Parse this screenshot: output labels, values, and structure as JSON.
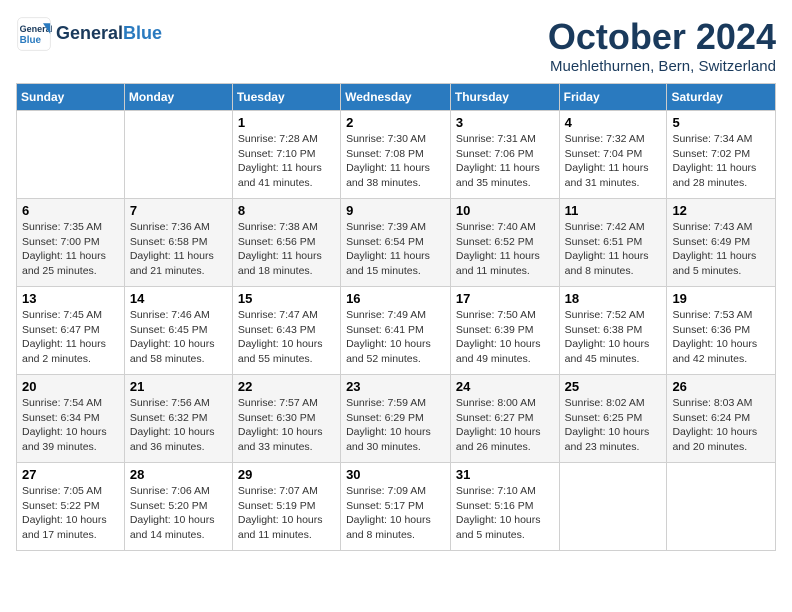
{
  "header": {
    "logo_line1": "General",
    "logo_line2": "Blue",
    "month": "October 2024",
    "location": "Muehlethurnen, Bern, Switzerland"
  },
  "days_of_week": [
    "Sunday",
    "Monday",
    "Tuesday",
    "Wednesday",
    "Thursday",
    "Friday",
    "Saturday"
  ],
  "weeks": [
    [
      {
        "day": "",
        "info": ""
      },
      {
        "day": "",
        "info": ""
      },
      {
        "day": "1",
        "info": "Sunrise: 7:28 AM\nSunset: 7:10 PM\nDaylight: 11 hours and 41 minutes."
      },
      {
        "day": "2",
        "info": "Sunrise: 7:30 AM\nSunset: 7:08 PM\nDaylight: 11 hours and 38 minutes."
      },
      {
        "day": "3",
        "info": "Sunrise: 7:31 AM\nSunset: 7:06 PM\nDaylight: 11 hours and 35 minutes."
      },
      {
        "day": "4",
        "info": "Sunrise: 7:32 AM\nSunset: 7:04 PM\nDaylight: 11 hours and 31 minutes."
      },
      {
        "day": "5",
        "info": "Sunrise: 7:34 AM\nSunset: 7:02 PM\nDaylight: 11 hours and 28 minutes."
      }
    ],
    [
      {
        "day": "6",
        "info": "Sunrise: 7:35 AM\nSunset: 7:00 PM\nDaylight: 11 hours and 25 minutes."
      },
      {
        "day": "7",
        "info": "Sunrise: 7:36 AM\nSunset: 6:58 PM\nDaylight: 11 hours and 21 minutes."
      },
      {
        "day": "8",
        "info": "Sunrise: 7:38 AM\nSunset: 6:56 PM\nDaylight: 11 hours and 18 minutes."
      },
      {
        "day": "9",
        "info": "Sunrise: 7:39 AM\nSunset: 6:54 PM\nDaylight: 11 hours and 15 minutes."
      },
      {
        "day": "10",
        "info": "Sunrise: 7:40 AM\nSunset: 6:52 PM\nDaylight: 11 hours and 11 minutes."
      },
      {
        "day": "11",
        "info": "Sunrise: 7:42 AM\nSunset: 6:51 PM\nDaylight: 11 hours and 8 minutes."
      },
      {
        "day": "12",
        "info": "Sunrise: 7:43 AM\nSunset: 6:49 PM\nDaylight: 11 hours and 5 minutes."
      }
    ],
    [
      {
        "day": "13",
        "info": "Sunrise: 7:45 AM\nSunset: 6:47 PM\nDaylight: 11 hours and 2 minutes."
      },
      {
        "day": "14",
        "info": "Sunrise: 7:46 AM\nSunset: 6:45 PM\nDaylight: 10 hours and 58 minutes."
      },
      {
        "day": "15",
        "info": "Sunrise: 7:47 AM\nSunset: 6:43 PM\nDaylight: 10 hours and 55 minutes."
      },
      {
        "day": "16",
        "info": "Sunrise: 7:49 AM\nSunset: 6:41 PM\nDaylight: 10 hours and 52 minutes."
      },
      {
        "day": "17",
        "info": "Sunrise: 7:50 AM\nSunset: 6:39 PM\nDaylight: 10 hours and 49 minutes."
      },
      {
        "day": "18",
        "info": "Sunrise: 7:52 AM\nSunset: 6:38 PM\nDaylight: 10 hours and 45 minutes."
      },
      {
        "day": "19",
        "info": "Sunrise: 7:53 AM\nSunset: 6:36 PM\nDaylight: 10 hours and 42 minutes."
      }
    ],
    [
      {
        "day": "20",
        "info": "Sunrise: 7:54 AM\nSunset: 6:34 PM\nDaylight: 10 hours and 39 minutes."
      },
      {
        "day": "21",
        "info": "Sunrise: 7:56 AM\nSunset: 6:32 PM\nDaylight: 10 hours and 36 minutes."
      },
      {
        "day": "22",
        "info": "Sunrise: 7:57 AM\nSunset: 6:30 PM\nDaylight: 10 hours and 33 minutes."
      },
      {
        "day": "23",
        "info": "Sunrise: 7:59 AM\nSunset: 6:29 PM\nDaylight: 10 hours and 30 minutes."
      },
      {
        "day": "24",
        "info": "Sunrise: 8:00 AM\nSunset: 6:27 PM\nDaylight: 10 hours and 26 minutes."
      },
      {
        "day": "25",
        "info": "Sunrise: 8:02 AM\nSunset: 6:25 PM\nDaylight: 10 hours and 23 minutes."
      },
      {
        "day": "26",
        "info": "Sunrise: 8:03 AM\nSunset: 6:24 PM\nDaylight: 10 hours and 20 minutes."
      }
    ],
    [
      {
        "day": "27",
        "info": "Sunrise: 7:05 AM\nSunset: 5:22 PM\nDaylight: 10 hours and 17 minutes."
      },
      {
        "day": "28",
        "info": "Sunrise: 7:06 AM\nSunset: 5:20 PM\nDaylight: 10 hours and 14 minutes."
      },
      {
        "day": "29",
        "info": "Sunrise: 7:07 AM\nSunset: 5:19 PM\nDaylight: 10 hours and 11 minutes."
      },
      {
        "day": "30",
        "info": "Sunrise: 7:09 AM\nSunset: 5:17 PM\nDaylight: 10 hours and 8 minutes."
      },
      {
        "day": "31",
        "info": "Sunrise: 7:10 AM\nSunset: 5:16 PM\nDaylight: 10 hours and 5 minutes."
      },
      {
        "day": "",
        "info": ""
      },
      {
        "day": "",
        "info": ""
      }
    ]
  ]
}
